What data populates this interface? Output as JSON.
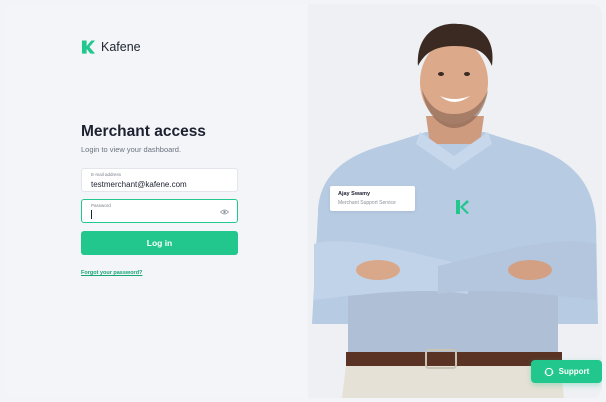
{
  "brand": {
    "name": "Kafene",
    "logo_icon": "kafene-logo-icon",
    "accent_color": "#22c78e"
  },
  "login": {
    "title": "Merchant access",
    "subtitle": "Login to view your dashboard.",
    "email": {
      "label": "E-mail address",
      "value": "testmerchant@kafene.com"
    },
    "password": {
      "label": "Password",
      "value": "",
      "icon": "eye-icon"
    },
    "submit_label": "Log in",
    "forgot_label": "Forgot your password?"
  },
  "badge": {
    "name": "Ajay Swamy",
    "role": "Merchant Support Service"
  },
  "support": {
    "label": "Support",
    "icon": "chat-support-icon"
  }
}
